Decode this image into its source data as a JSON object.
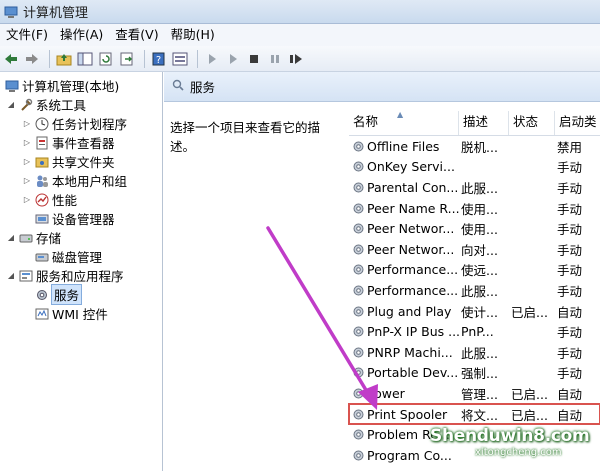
{
  "window": {
    "title": "计算机管理"
  },
  "menu": [
    "文件(F)",
    "操作(A)",
    "查看(V)",
    "帮助(H)"
  ],
  "tree": {
    "root": "计算机管理(本地)",
    "system_tools": "系统工具",
    "task_scheduler": "任务计划程序",
    "event_viewer": "事件查看器",
    "shared_folders": "共享文件夹",
    "local_users": "本地用户和组",
    "performance": "性能",
    "device_manager": "设备管理器",
    "storage": "存储",
    "disk_management": "磁盘管理",
    "services_apps": "服务和应用程序",
    "services": "服务",
    "wmi": "WMI 控件"
  },
  "services_pane": {
    "header": "服务",
    "description_hint": "选择一个项目来查看它的描述。",
    "columns": [
      "名称",
      "描述",
      "状态",
      "启动类"
    ]
  },
  "services": [
    {
      "name": "Offline Files",
      "desc": "脱机...",
      "status": "",
      "startup": "禁用"
    },
    {
      "name": "OnKey Servi...",
      "desc": "",
      "status": "",
      "startup": "手动"
    },
    {
      "name": "Parental Con...",
      "desc": "此服...",
      "status": "",
      "startup": "手动"
    },
    {
      "name": "Peer Name R...",
      "desc": "使用...",
      "status": "",
      "startup": "手动"
    },
    {
      "name": "Peer Networ...",
      "desc": "使用...",
      "status": "",
      "startup": "手动"
    },
    {
      "name": "Peer Networ...",
      "desc": "向对...",
      "status": "",
      "startup": "手动"
    },
    {
      "name": "Performance...",
      "desc": "使远...",
      "status": "",
      "startup": "手动"
    },
    {
      "name": "Performance...",
      "desc": "此服...",
      "status": "",
      "startup": "手动"
    },
    {
      "name": "Plug and Play",
      "desc": "使计...",
      "status": "已启...",
      "startup": "自动"
    },
    {
      "name": "PnP-X IP Bus ...",
      "desc": "PnP...",
      "status": "",
      "startup": "手动"
    },
    {
      "name": "PNRP Machi...",
      "desc": "此服...",
      "status": "",
      "startup": "手动"
    },
    {
      "name": "Portable Dev...",
      "desc": "强制...",
      "status": "",
      "startup": "手动"
    },
    {
      "name": "Power",
      "desc": "管理...",
      "status": "已启...",
      "startup": "自动"
    },
    {
      "name": "Print Spooler",
      "desc": "将文...",
      "status": "已启...",
      "startup": "自动"
    },
    {
      "name": "Problem Re...",
      "desc": "",
      "status": "",
      "startup": ""
    },
    {
      "name": "Program Co...",
      "desc": "",
      "status": "",
      "startup": ""
    }
  ],
  "watermark": {
    "main": "Shenduwin8.com",
    "sub": "xitongcheng.com"
  },
  "colors": {
    "annotation_arrow": "#c03cc8",
    "highlight_box": "#d9534f",
    "watermark_glow": "#2a7a2a"
  }
}
